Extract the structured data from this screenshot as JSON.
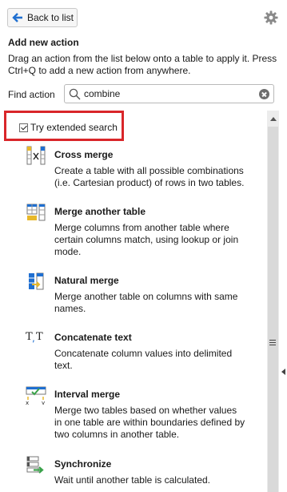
{
  "header": {
    "back_label": "Back to list",
    "back_icon": "arrow-left-icon",
    "settings_icon": "gear-icon"
  },
  "panel": {
    "heading": "Add new action",
    "description": "Drag an action from the list below onto a table to apply it. Press Ctrl+Q to add a new action from anywhere."
  },
  "find": {
    "label": "Find action",
    "value": "combine",
    "search_icon": "search-icon",
    "clear_icon": "clear-icon"
  },
  "extended_search": {
    "label": "Try extended search",
    "checked": true
  },
  "actions": [
    {
      "title": "Cross merge",
      "description": "Create a table with all possible combinations (i.e. Cartesian product) of rows in two tables.",
      "icon": "cross-merge-icon"
    },
    {
      "title": "Merge another table",
      "description": "Merge columns from another table where certain columns match, using lookup or join mode.",
      "icon": "merge-table-icon"
    },
    {
      "title": "Natural merge",
      "description": "Merge another table on columns with same names.",
      "icon": "natural-merge-icon"
    },
    {
      "title": "Concatenate text",
      "description": "Concatenate column values into delimited text.",
      "icon": "concatenate-text-icon"
    },
    {
      "title": "Interval merge",
      "description": "Merge two tables based on whether values in one table are within boundaries defined by two columns in another table.",
      "icon": "interval-merge-icon"
    },
    {
      "title": "Synchronize",
      "description": "Wait until another table is calculated.",
      "icon": "synchronize-icon"
    }
  ],
  "colors": {
    "accent_blue": "#1f6fd1",
    "highlight_red": "#d9262a",
    "icon_yellow": "#e8b82a",
    "icon_green": "#3aa14a"
  }
}
